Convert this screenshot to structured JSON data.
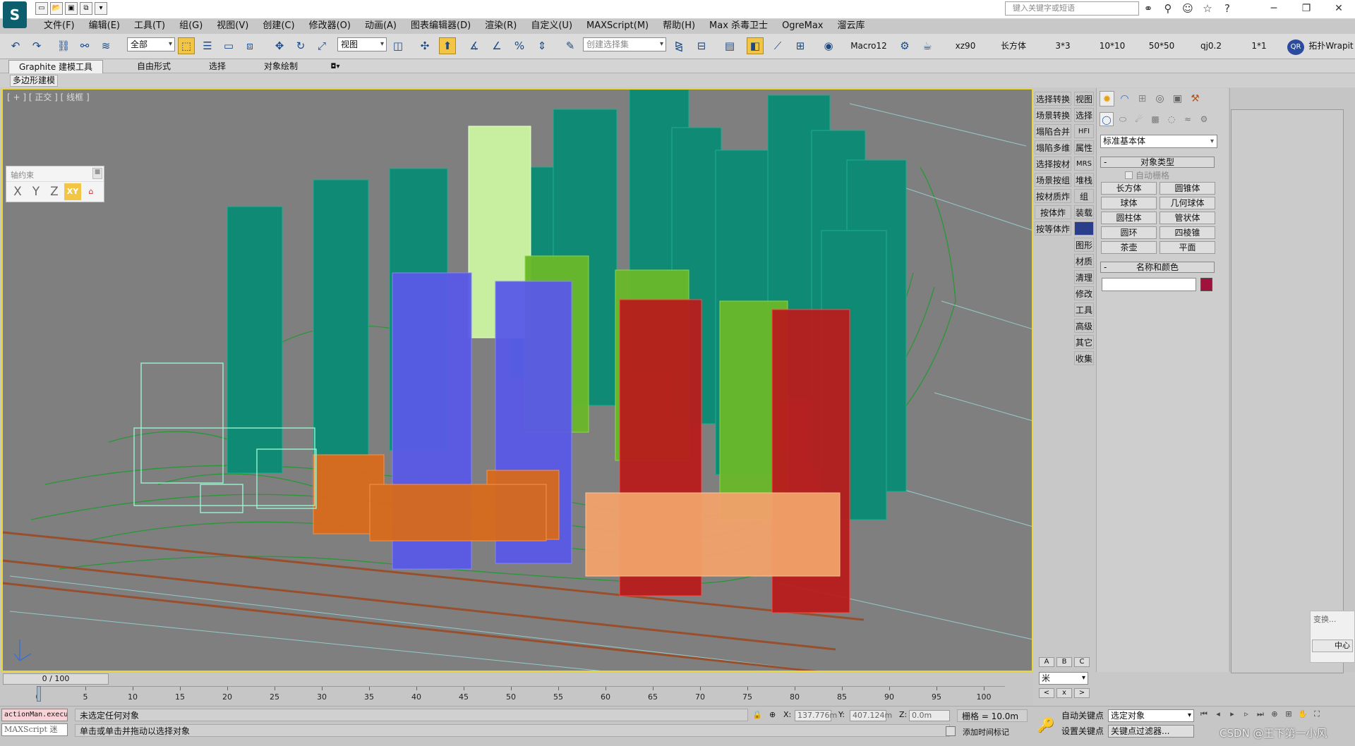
{
  "titlebar": {
    "search_placeholder": "键入关键字或短语",
    "window_controls": [
      "─",
      "❐",
      "✕"
    ]
  },
  "menu": [
    "文件(F)",
    "编辑(E)",
    "工具(T)",
    "组(G)",
    "视图(V)",
    "创建(C)",
    "修改器(O)",
    "动画(A)",
    "图表编辑器(D)",
    "渲染(R)",
    "自定义(U)",
    "MAXScript(M)",
    "帮助(H)",
    "Max 杀毒卫士",
    "OgreMax",
    "溜云库"
  ],
  "toolbar": {
    "selection_filter": "全部",
    "ref_coord": "视图",
    "named_selection": "创建选择集",
    "macro_buttons": [
      "Macro12",
      "xz90",
      "长方体",
      "3*3",
      "10*10",
      "50*50",
      "qj0.2",
      "1*1"
    ],
    "qr_label": "QR",
    "topo_label": "拓扑Wrapit"
  },
  "ribbon": {
    "tabs": [
      "Graphite 建模工具",
      "自由形式",
      "选择",
      "对象绘制"
    ],
    "panel_label": "多边形建模"
  },
  "viewport": {
    "label": "[ + ] [ 正交 ] [ 线框 ]",
    "axis_panel_title": "轴约束",
    "axis_buttons": [
      "X",
      "Y",
      "Z",
      "XY"
    ]
  },
  "command_column": {
    "left": [
      "选择转换",
      "场景转换",
      "塌陷合并",
      "塌陷多维",
      "选择按材",
      "场景按组",
      "按材质炸",
      "按体炸",
      "按等体炸"
    ],
    "right": [
      "视图",
      "选择",
      "HFI",
      "属性",
      "MRS",
      "堆栈",
      "组",
      "装载",
      "",
      "图形",
      "材质",
      "清理",
      "修改",
      "工具",
      "高级",
      "其它",
      "收集"
    ]
  },
  "command_panel": {
    "category": "标准基本体",
    "object_type_title": "对象类型",
    "auto_grid": "自动栅格",
    "objects": [
      "长方体",
      "圆锥体",
      "球体",
      "几何球体",
      "圆柱体",
      "管状体",
      "圆环",
      "四棱锥",
      "茶壶",
      "平面"
    ],
    "name_color_title": "名称和颜色",
    "object_color": "#a0123c"
  },
  "floating_dialog": {
    "title": "变换...",
    "button": "中心"
  },
  "timeline": {
    "frame_display": "0 / 100",
    "ticks": [
      "0",
      "5",
      "10",
      "15",
      "20",
      "25",
      "30",
      "35",
      "40",
      "45",
      "50",
      "55",
      "60",
      "65",
      "70",
      "75",
      "80",
      "85",
      "90",
      "95",
      "100"
    ],
    "abc": [
      "A",
      "B",
      "C"
    ],
    "unit": "米",
    "nav": [
      "<",
      "x",
      ">"
    ]
  },
  "status": {
    "listener_top": "actionMan.execu",
    "listener_bottom": "MAXScript 迷",
    "message": "未选定任何对象",
    "prompt": "单击或单击并拖动以选择对象",
    "x_label": "X:",
    "x_value": "137.776m",
    "y_label": "Y:",
    "y_value": "407.124m",
    "z_label": "Z:",
    "z_value": "0.0m",
    "grid": "栅格 = 10.0m",
    "add_time_tag": "添加时间标记",
    "auto_key": "自动关键点",
    "set_key": "设置关键点",
    "selected_objects": "选定对象",
    "key_filters": "关键点过滤器...",
    "watermark": "CSDN @王下第一小风"
  }
}
